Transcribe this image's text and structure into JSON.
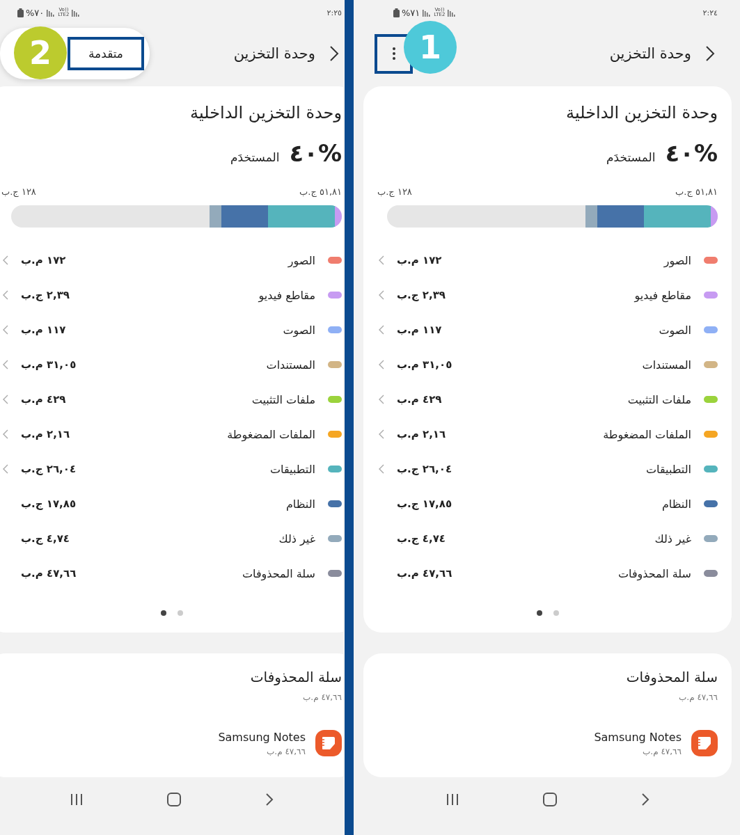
{
  "panels": [
    {
      "status_bar": {
        "battery": "%٧١",
        "network_top": "Vo))",
        "network_bottom": "LTE2",
        "time": "٢:٢٤"
      },
      "header": {
        "title": "وحدة التخزين",
        "menu_open": false
      },
      "step_badge": "1",
      "storage": {
        "title": "وحدة التخزين الداخلية",
        "percent": "٤٠%",
        "used_label": "المستخدَم",
        "used_amount": "٥١,٨١ ج.ب",
        "total": "١٢٨ ج.ب",
        "categories": [
          {
            "label": "الصور",
            "size": "١٧٢ م.ب",
            "color": "#f07d6e",
            "navigable": true
          },
          {
            "label": "مقاطع فيديو",
            "size": "٢,٣٩ ج.ب",
            "color": "#c79bf2",
            "navigable": true
          },
          {
            "label": "الصوت",
            "size": "١١٧ م.ب",
            "color": "#8fb0f5",
            "navigable": true
          },
          {
            "label": "المستندات",
            "size": "٣١,٠٥ م.ب",
            "color": "#d2b586",
            "navigable": true
          },
          {
            "label": "ملفات التثبيت",
            "size": "٤٢٩ م.ب",
            "color": "#9bd33c",
            "navigable": true
          },
          {
            "label": "الملفات المضغوطة",
            "size": "٢,١٦ م.ب",
            "color": "#f5a623",
            "navigable": true
          },
          {
            "label": "التطبيقات",
            "size": "٢٦,٠٤ ج.ب",
            "color": "#55b4bc",
            "navigable": true
          },
          {
            "label": "النظام",
            "size": "١٧,٨٥ ج.ب",
            "color": "#4672a8",
            "navigable": false
          },
          {
            "label": "غير ذلك",
            "size": "٤,٧٤ ج.ب",
            "color": "#93aabb",
            "navigable": false
          },
          {
            "label": "سلة المحذوفات",
            "size": "٤٧,٦٦ م.ب",
            "color": "#8a8c9c",
            "navigable": false
          }
        ],
        "pages": [
          {
            "selected": true
          },
          {
            "selected": false
          }
        ]
      },
      "trash": {
        "title": "سلة المحذوفات",
        "size": "٤٧,٦٦ م.ب",
        "apps": [
          {
            "name": "Samsung Notes",
            "size": "٤٧,٦٦ م.ب"
          }
        ]
      }
    },
    {
      "status_bar": {
        "battery": "%٧٠",
        "network_top": "Vo))",
        "network_bottom": "LTE2",
        "time": "٢:٢٥"
      },
      "header": {
        "title": "وحدة التخزين",
        "menu_open": true,
        "menu_items": [
          {
            "label": "متقدمة"
          }
        ]
      },
      "step_badge": "2",
      "storage": {
        "title": "وحدة التخزين الداخلية",
        "percent": "٤٠%",
        "used_label": "المستخدَم",
        "used_amount": "٥١,٨١ ج.ب",
        "total": "١٢٨ ج.ب",
        "categories": [
          {
            "label": "الصور",
            "size": "١٧٢ م.ب",
            "color": "#f07d6e",
            "navigable": true
          },
          {
            "label": "مقاطع فيديو",
            "size": "٢,٣٩ ج.ب",
            "color": "#c79bf2",
            "navigable": true
          },
          {
            "label": "الصوت",
            "size": "١١٧ م.ب",
            "color": "#8fb0f5",
            "navigable": true
          },
          {
            "label": "المستندات",
            "size": "٣١,٠٥ م.ب",
            "color": "#d2b586",
            "navigable": true
          },
          {
            "label": "ملفات التثبيت",
            "size": "٤٢٩ م.ب",
            "color": "#9bd33c",
            "navigable": true
          },
          {
            "label": "الملفات المضغوطة",
            "size": "٢,١٦ م.ب",
            "color": "#f5a623",
            "navigable": true
          },
          {
            "label": "التطبيقات",
            "size": "٢٦,٠٤ ج.ب",
            "color": "#55b4bc",
            "navigable": true
          },
          {
            "label": "النظام",
            "size": "١٧,٨٥ ج.ب",
            "color": "#4672a8",
            "navigable": false
          },
          {
            "label": "غير ذلك",
            "size": "٤,٧٤ ج.ب",
            "color": "#93aabb",
            "navigable": false
          },
          {
            "label": "سلة المحذوفات",
            "size": "٤٧,٦٦ م.ب",
            "color": "#8a8c9c",
            "navigable": false
          }
        ],
        "pages": [
          {
            "selected": true
          },
          {
            "selected": false
          }
        ]
      },
      "trash": {
        "title": "سلة المحذوفات",
        "size": "٤٧,٦٦ م.ب",
        "apps": [
          {
            "name": "Samsung Notes",
            "size": "٤٧,٦٦ م.ب"
          }
        ]
      }
    }
  ]
}
